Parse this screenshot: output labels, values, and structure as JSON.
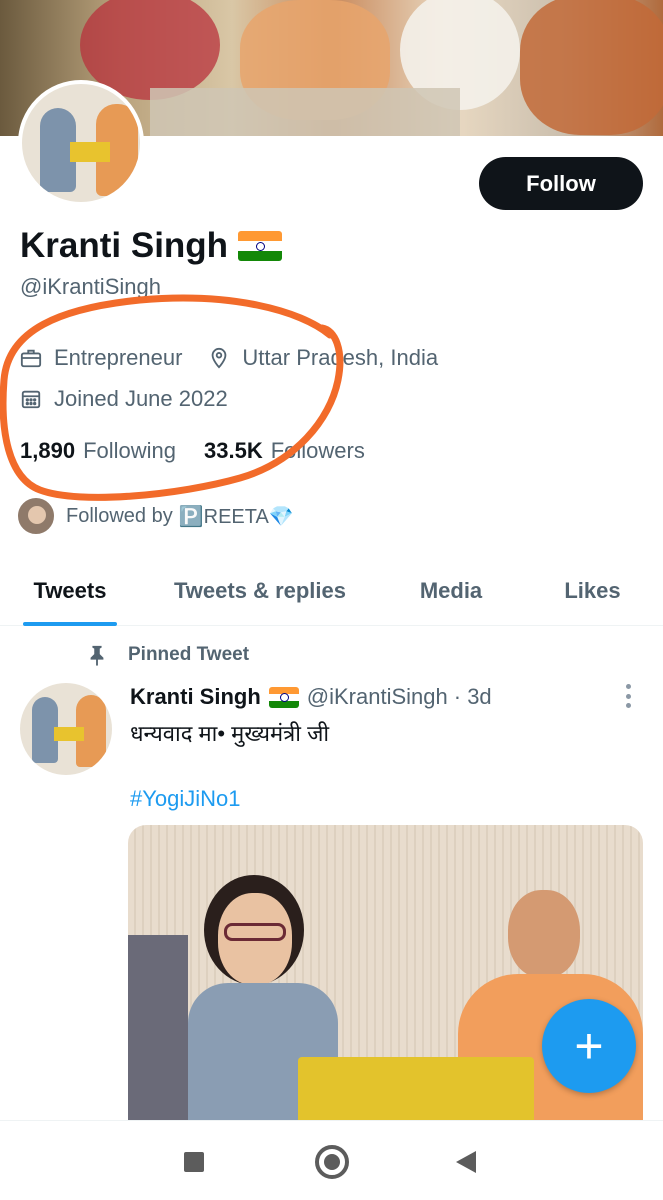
{
  "profile": {
    "name": "Kranti Singh",
    "handle": "@iKrantiSingh",
    "follow_label": "Follow",
    "occupation": "Entrepreneur",
    "location": "Uttar Pradesh, India",
    "joined": "Joined June 2022",
    "following_count": "1,890",
    "following_label": "Following",
    "followers_count": "33.5K",
    "followers_label": "Followers",
    "followed_by_prefix": "Followed by",
    "followed_by_name": "🅿️REETA💎"
  },
  "tabs": [
    {
      "label": "Tweets"
    },
    {
      "label": "Tweets & replies"
    },
    {
      "label": "Media"
    },
    {
      "label": "Likes"
    }
  ],
  "pinned_tweet": {
    "label": "Pinned Tweet",
    "author": "Kranti Singh",
    "handle": "@iKrantiSingh",
    "time": "· 3d",
    "text": "धन्यवाद मा• मुख्यमंत्री जी",
    "hashtag": "#YogiJiNo1"
  },
  "fab": {
    "label": "+"
  },
  "colors": {
    "accent": "#1d9bf0",
    "annotation": "#f26b2a",
    "text_primary": "#0f1419",
    "text_secondary": "#536471"
  }
}
